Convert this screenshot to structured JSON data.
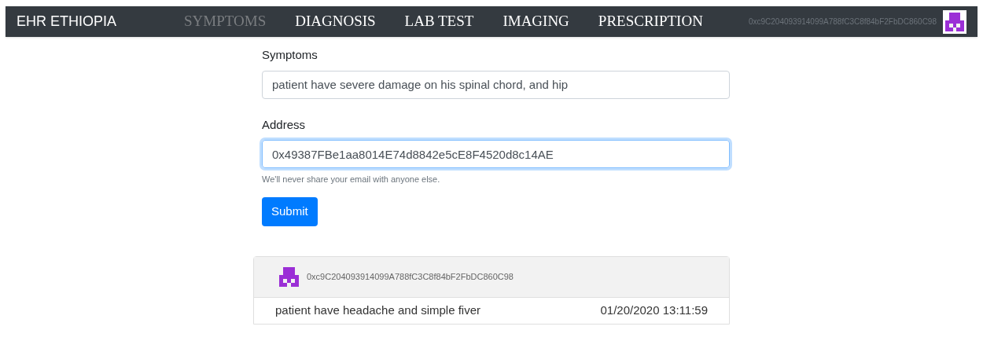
{
  "navbar": {
    "brand": "EHR ETHIOPIA",
    "tabs": [
      {
        "label": "SYMPTOMS",
        "selected": true
      },
      {
        "label": "DIAGNOSIS",
        "selected": false
      },
      {
        "label": "LAB TEST",
        "selected": false
      },
      {
        "label": "IMAGING",
        "selected": false
      },
      {
        "label": "PRESCRIPTION",
        "selected": false
      }
    ],
    "account": "0xc9C204093914099A788fC3C8f84bF2FbDC860C98"
  },
  "form": {
    "fields": [
      {
        "label": "Symptoms",
        "value": "patient have severe damage on his spinal chord, and hip",
        "focused": false
      },
      {
        "label": "Address",
        "value": "0x49387FBe1aa8014E74d8842e5cE8F4520d8c14AE",
        "focused": true,
        "help": "We'll never share your email with anyone else."
      }
    ],
    "submit": "Submit"
  },
  "records": [
    {
      "account": "0xc9C204093914099A788fC3C8f84bF2FbDC860C98",
      "text": "patient have headache and simple fiver",
      "time": "01/20/2020 13:11:59"
    }
  ]
}
